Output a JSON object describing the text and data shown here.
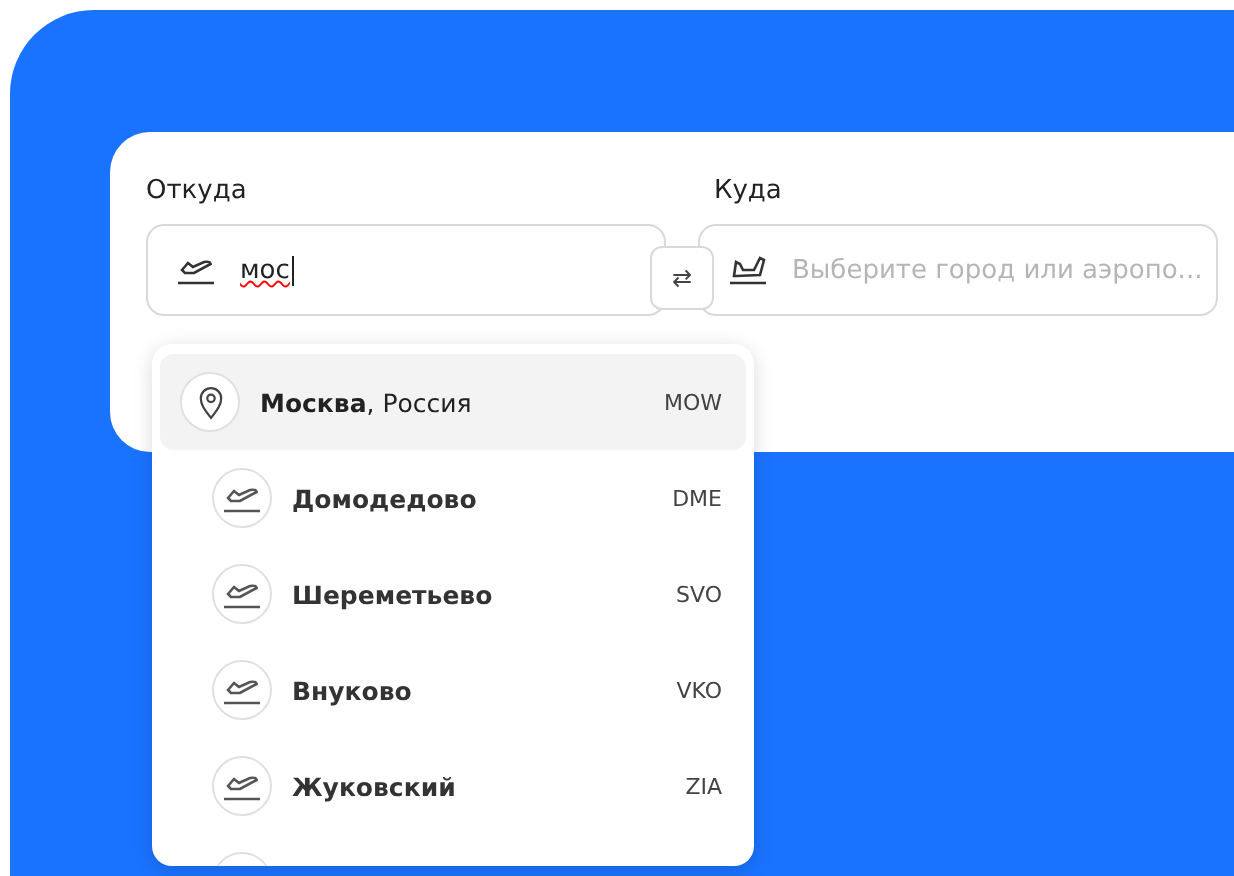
{
  "from_field": {
    "label": "Откуда",
    "value": "мос"
  },
  "swap_button": {
    "label": "⇄"
  },
  "to_field": {
    "label": "Куда",
    "placeholder": "Выберите город или аэропо..."
  },
  "suggestions": [
    {
      "kind": "city",
      "name": "**Москва**, Россия",
      "code": "MOW",
      "selected": true
    },
    {
      "kind": "airport",
      "name": "Домодедово",
      "code": "DME",
      "selected": false
    },
    {
      "kind": "airport",
      "name": "Шереметьево",
      "code": "SVO",
      "selected": false
    },
    {
      "kind": "airport",
      "name": "Внуково",
      "code": "VKO",
      "selected": false
    },
    {
      "kind": "airport",
      "name": "Жуковский",
      "code": "ZIA",
      "selected": false
    }
  ]
}
